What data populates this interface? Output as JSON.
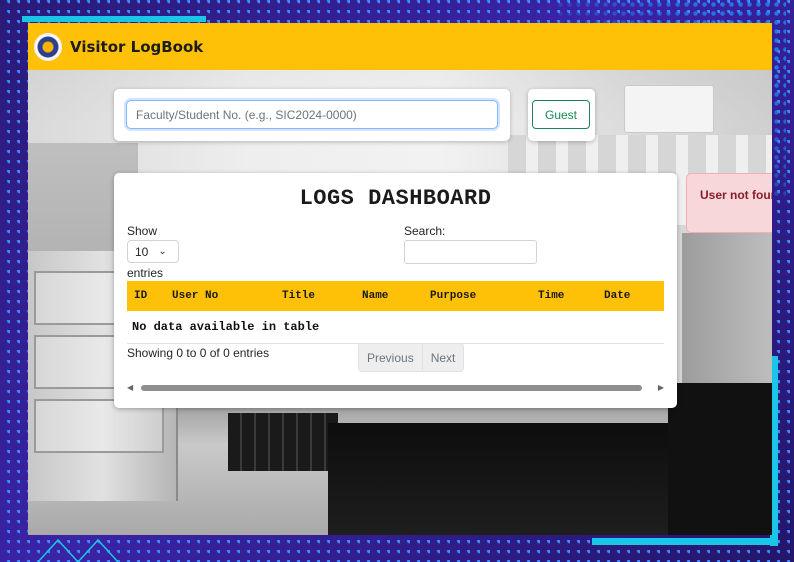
{
  "app": {
    "title": "Visitor LogBook"
  },
  "search": {
    "placeholder": "Faculty/Student No. (e.g., SIC2024-0000)",
    "value": ""
  },
  "guest_button": {
    "label": "Guest"
  },
  "dashboard": {
    "title": "LOGS DASHBOARD",
    "show_label": "Show",
    "page_length": "10",
    "entries_label": "entries",
    "search_label": "Search:",
    "columns": [
      "ID",
      "User No",
      "Title",
      "Name",
      "Purpose",
      "Time",
      "Date"
    ],
    "empty_message": "No data available in table",
    "info": "Showing 0 to 0 of 0 entries",
    "pagination": {
      "previous": "Previous",
      "next": "Next"
    }
  },
  "toast": {
    "message": "User not found"
  },
  "colors": {
    "header": "#ffc107",
    "accent_cyan": "#19c6e8",
    "outer_bg": "#2b1f7a",
    "guest_green": "#198754",
    "toast_bg": "#f8d7da",
    "toast_text": "#842029"
  },
  "icons": {
    "logo": "seal-logo-icon",
    "select": "chevron-down-icon",
    "scroll_left": "arrow-left-icon",
    "scroll_right": "arrow-right-icon"
  }
}
